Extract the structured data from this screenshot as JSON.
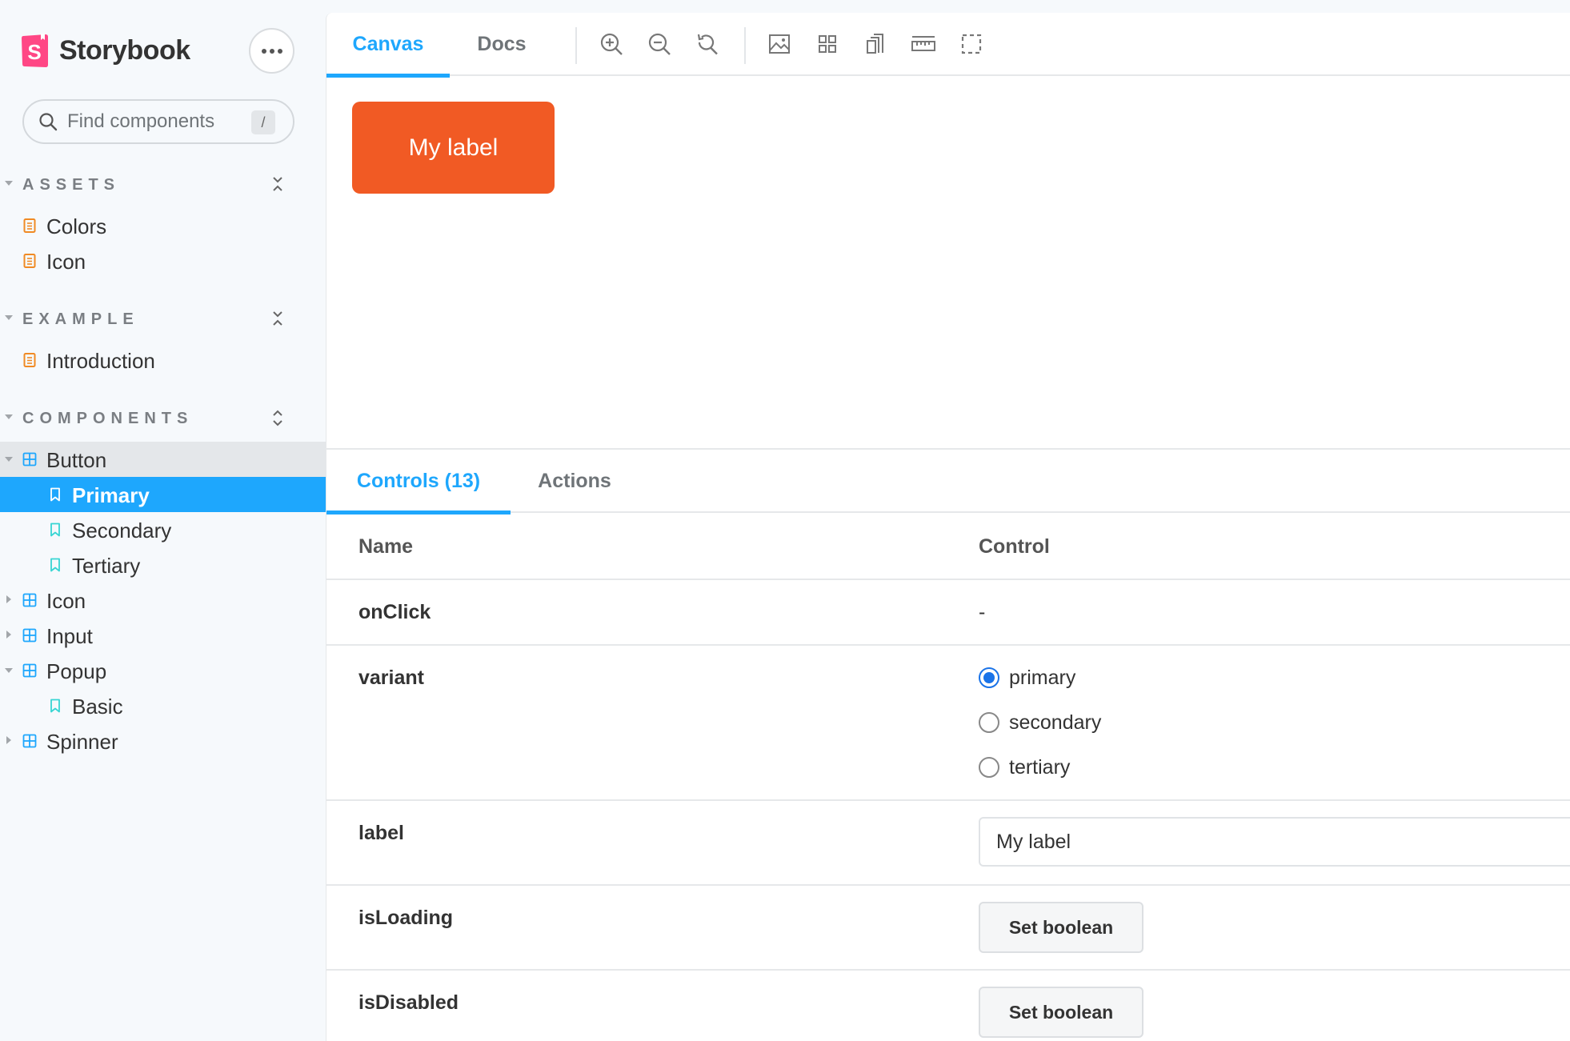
{
  "sidebar": {
    "brand": "Storybook",
    "search": {
      "placeholder": "Find components",
      "shortcut": "/"
    },
    "sections": [
      {
        "label": "ASSETS"
      },
      {
        "label": "EXAMPLE"
      },
      {
        "label": "COMPONENTS"
      }
    ],
    "items": {
      "colors": "Colors",
      "icon_doc": "Icon",
      "introduction": "Introduction",
      "button": "Button",
      "primary": "Primary",
      "secondary": "Secondary",
      "tertiary": "Tertiary",
      "icon": "Icon",
      "input": "Input",
      "popup": "Popup",
      "basic": "Basic",
      "spinner": "Spinner"
    }
  },
  "toolbar": {
    "tabs": [
      "Canvas",
      "Docs"
    ],
    "active_tab": "Canvas",
    "tools": [
      "zoom-in-icon",
      "zoom-out-icon",
      "zoom-reset-icon",
      "background-icon",
      "grid-icon",
      "viewport-icon",
      "measure-icon",
      "outline-icon"
    ]
  },
  "preview": {
    "button_label": "My label",
    "button_color": "#f15a24"
  },
  "addons": {
    "tabs": [
      "Controls (13)",
      "Actions"
    ],
    "active_tab": "Controls (13)",
    "headers": {
      "name": "Name",
      "control": "Control"
    },
    "rows": {
      "onClick": {
        "name": "onClick",
        "value": "-"
      },
      "variant": {
        "name": "variant",
        "options": [
          "primary",
          "secondary",
          "tertiary"
        ],
        "selected": "primary"
      },
      "label": {
        "name": "label",
        "value": "My label"
      },
      "isLoading": {
        "name": "isLoading",
        "button": "Set boolean"
      },
      "isDisabled": {
        "name": "isDisabled",
        "button": "Set boolean"
      }
    }
  },
  "colors": {
    "accent": "#1ea7fd",
    "brand": "#ff4785",
    "doc_icon": "#f08a24",
    "story_icon": "#37d5d3"
  }
}
